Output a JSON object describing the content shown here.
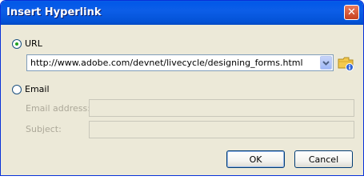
{
  "window": {
    "title": "Insert Hyperlink",
    "close_glyph": "✕"
  },
  "url_option": {
    "label": "URL",
    "selected": true,
    "value": "http://www.adobe.com/devnet/livecycle/designing_forms.html"
  },
  "email_option": {
    "label": "Email",
    "selected": false,
    "address_label": "Email address:",
    "address_value": "",
    "subject_label": "Subject:",
    "subject_value": ""
  },
  "buttons": {
    "ok": "OK",
    "cancel": "Cancel"
  },
  "icons": {
    "dropdown": "chevron-down-icon",
    "browse": "folder-browse-icon",
    "close": "close-icon"
  },
  "colors": {
    "title_bar": "#0258e8",
    "dialog_bg": "#ece9d8",
    "radio_dot": "#21a121",
    "disabled_text": "#aca899"
  }
}
